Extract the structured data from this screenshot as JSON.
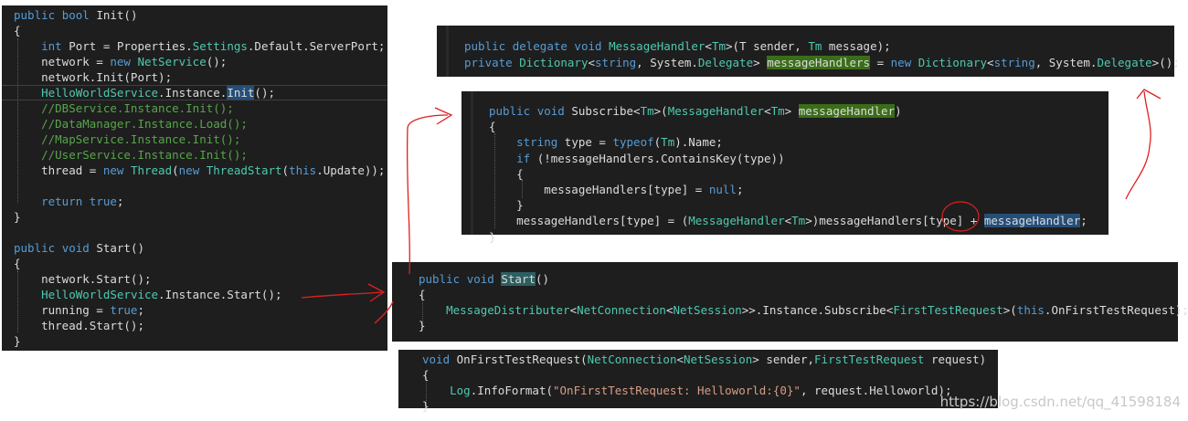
{
  "panel_init": {
    "lines": [
      [
        {
          "t": "public ",
          "c": "kw"
        },
        {
          "t": "bool ",
          "c": "kw"
        },
        {
          "t": "Init()",
          "c": ""
        }
      ],
      [
        {
          "t": "{",
          "c": ""
        }
      ],
      [
        {
          "t": "    ",
          "c": ""
        },
        {
          "t": "int ",
          "c": "kw"
        },
        {
          "t": "Port = Properties.",
          "c": ""
        },
        {
          "t": "Settings",
          "c": "ty"
        },
        {
          "t": ".Default.ServerPort;",
          "c": ""
        }
      ],
      [
        {
          "t": "    network = ",
          "c": ""
        },
        {
          "t": "new ",
          "c": "kw"
        },
        {
          "t": "NetService",
          "c": "ty"
        },
        {
          "t": "();",
          "c": ""
        }
      ],
      [
        {
          "t": "    network.Init(Port);",
          "c": ""
        }
      ],
      [
        {
          "t": "    ",
          "c": ""
        },
        {
          "t": "HelloWorldService",
          "c": "ty"
        },
        {
          "t": ".Instance.",
          "c": ""
        },
        {
          "t": "Init",
          "c": "hl-blue"
        },
        {
          "t": "();",
          "c": ""
        }
      ],
      [
        {
          "t": "    //DBService.Instance.Init();",
          "c": "cm"
        }
      ],
      [
        {
          "t": "    //DataManager.Instance.Load();",
          "c": "cm"
        }
      ],
      [
        {
          "t": "    //MapService.Instance.Init();",
          "c": "cm"
        }
      ],
      [
        {
          "t": "    //UserService.Instance.Init();",
          "c": "cm"
        }
      ],
      [
        {
          "t": "    thread = ",
          "c": ""
        },
        {
          "t": "new ",
          "c": "kw"
        },
        {
          "t": "Thread",
          "c": "ty"
        },
        {
          "t": "(",
          "c": ""
        },
        {
          "t": "new ",
          "c": "kw"
        },
        {
          "t": "ThreadStart",
          "c": "ty"
        },
        {
          "t": "(",
          "c": ""
        },
        {
          "t": "this",
          "c": "kw"
        },
        {
          "t": ".Update));",
          "c": ""
        }
      ],
      [
        {
          "t": "",
          "c": ""
        }
      ],
      [
        {
          "t": "    ",
          "c": ""
        },
        {
          "t": "return ",
          "c": "kw"
        },
        {
          "t": "true",
          "c": "kw"
        },
        {
          "t": ";",
          "c": ""
        }
      ],
      [
        {
          "t": "}",
          "c": ""
        }
      ],
      [
        {
          "t": "",
          "c": ""
        }
      ],
      [
        {
          "t": "public ",
          "c": "kw"
        },
        {
          "t": "void ",
          "c": "kw"
        },
        {
          "t": "Start()",
          "c": ""
        }
      ],
      [
        {
          "t": "{",
          "c": ""
        }
      ],
      [
        {
          "t": "    network.Start();",
          "c": ""
        }
      ],
      [
        {
          "t": "    ",
          "c": ""
        },
        {
          "t": "HelloWorldService",
          "c": "ty"
        },
        {
          "t": ".Instance.Start();",
          "c": ""
        }
      ],
      [
        {
          "t": "    running = ",
          "c": ""
        },
        {
          "t": "true",
          "c": "kw"
        },
        {
          "t": ";",
          "c": ""
        }
      ],
      [
        {
          "t": "    thread.Start();",
          "c": ""
        }
      ],
      [
        {
          "t": "}",
          "c": ""
        }
      ]
    ]
  },
  "panel_delegate": {
    "lines": [
      [
        {
          "t": "public ",
          "c": "kw"
        },
        {
          "t": "delegate ",
          "c": "kw"
        },
        {
          "t": "void ",
          "c": "kw"
        },
        {
          "t": "MessageHandler",
          "c": "ty"
        },
        {
          "t": "<",
          "c": ""
        },
        {
          "t": "Tm",
          "c": "ty"
        },
        {
          "t": ">(T sender, ",
          "c": ""
        },
        {
          "t": "Tm",
          "c": "ty"
        },
        {
          "t": " message);",
          "c": ""
        }
      ],
      [
        {
          "t": "private ",
          "c": "kw"
        },
        {
          "t": "Dictionary",
          "c": "ty"
        },
        {
          "t": "<",
          "c": ""
        },
        {
          "t": "string",
          "c": "kw"
        },
        {
          "t": ", System.",
          "c": ""
        },
        {
          "t": "Delegate",
          "c": "ty"
        },
        {
          "t": "> ",
          "c": ""
        },
        {
          "t": "messageHandlers",
          "c": "hl-green"
        },
        {
          "t": " = ",
          "c": ""
        },
        {
          "t": "new ",
          "c": "kw"
        },
        {
          "t": "Dictionary",
          "c": "ty"
        },
        {
          "t": "<",
          "c": ""
        },
        {
          "t": "string",
          "c": "kw"
        },
        {
          "t": ", System.",
          "c": ""
        },
        {
          "t": "Delegate",
          "c": "ty"
        },
        {
          "t": ">();",
          "c": ""
        }
      ]
    ]
  },
  "panel_subscribe": {
    "lines": [
      [
        {
          "t": "public ",
          "c": "kw"
        },
        {
          "t": "void ",
          "c": "kw"
        },
        {
          "t": "Subscribe<",
          "c": ""
        },
        {
          "t": "Tm",
          "c": "ty"
        },
        {
          "t": ">(",
          "c": ""
        },
        {
          "t": "MessageHandler",
          "c": "ty"
        },
        {
          "t": "<",
          "c": ""
        },
        {
          "t": "Tm",
          "c": "ty"
        },
        {
          "t": "> ",
          "c": ""
        },
        {
          "t": "messageHandler",
          "c": "hl-green"
        },
        {
          "t": ")",
          "c": ""
        }
      ],
      [
        {
          "t": "{",
          "c": ""
        }
      ],
      [
        {
          "t": "    ",
          "c": ""
        },
        {
          "t": "string ",
          "c": "kw"
        },
        {
          "t": "type = ",
          "c": ""
        },
        {
          "t": "typeof",
          "c": "kw"
        },
        {
          "t": "(",
          "c": ""
        },
        {
          "t": "Tm",
          "c": "ty"
        },
        {
          "t": ").Name;",
          "c": ""
        }
      ],
      [
        {
          "t": "    ",
          "c": ""
        },
        {
          "t": "if ",
          "c": "kw"
        },
        {
          "t": "(!messageHandlers.ContainsKey(type))",
          "c": ""
        }
      ],
      [
        {
          "t": "    {",
          "c": ""
        }
      ],
      [
        {
          "t": "        messageHandlers[type] = ",
          "c": ""
        },
        {
          "t": "null",
          "c": "kw"
        },
        {
          "t": ";",
          "c": ""
        }
      ],
      [
        {
          "t": "    }",
          "c": ""
        }
      ],
      [
        {
          "t": "    messageHandlers[type] = (",
          "c": ""
        },
        {
          "t": "MessageHandler",
          "c": "ty"
        },
        {
          "t": "<",
          "c": ""
        },
        {
          "t": "Tm",
          "c": "ty"
        },
        {
          "t": ">)messageHandlers[type] + ",
          "c": ""
        },
        {
          "t": "messageHandler",
          "c": "hl-blue"
        },
        {
          "t": ";",
          "c": ""
        }
      ],
      [
        {
          "t": "}",
          "c": ""
        }
      ]
    ]
  },
  "panel_start": {
    "lines": [
      [
        {
          "t": "public ",
          "c": "kw"
        },
        {
          "t": "void ",
          "c": "kw"
        },
        {
          "t": "Start",
          "c": "hl-teal"
        },
        {
          "t": "()",
          "c": ""
        }
      ],
      [
        {
          "t": "{",
          "c": ""
        }
      ],
      [
        {
          "t": "    ",
          "c": ""
        },
        {
          "t": "MessageDistributer",
          "c": "ty"
        },
        {
          "t": "<",
          "c": ""
        },
        {
          "t": "NetConnection",
          "c": "ty"
        },
        {
          "t": "<",
          "c": ""
        },
        {
          "t": "NetSession",
          "c": "ty"
        },
        {
          "t": ">>.Instance.Subscribe<",
          "c": ""
        },
        {
          "t": "FirstTestRequest",
          "c": "ty"
        },
        {
          "t": ">(",
          "c": ""
        },
        {
          "t": "this",
          "c": "kw"
        },
        {
          "t": ".OnFirstTestRequest);",
          "c": ""
        }
      ],
      [
        {
          "t": "}",
          "c": ""
        }
      ]
    ]
  },
  "panel_handler": {
    "lines": [
      [
        {
          "t": "void ",
          "c": "kw"
        },
        {
          "t": "OnFirstTestRequest(",
          "c": ""
        },
        {
          "t": "NetConnection",
          "c": "ty"
        },
        {
          "t": "<",
          "c": ""
        },
        {
          "t": "NetSession",
          "c": "ty"
        },
        {
          "t": "> sender,",
          "c": ""
        },
        {
          "t": "FirstTestRequest",
          "c": "ty"
        },
        {
          "t": " request)",
          "c": ""
        }
      ],
      [
        {
          "t": "{",
          "c": ""
        }
      ],
      [
        {
          "t": "    ",
          "c": ""
        },
        {
          "t": "Log",
          "c": "ty"
        },
        {
          "t": ".InfoFormat(",
          "c": ""
        },
        {
          "t": "\"OnFirstTestRequest: Helloworld:{0}\"",
          "c": "st"
        },
        {
          "t": ", request.Helloworld);",
          "c": ""
        }
      ],
      [
        {
          "t": "}",
          "c": ""
        }
      ]
    ]
  },
  "watermark": "https://blog.csdn.net/qq_41598184",
  "colors": {
    "editor_bg": "#1e1e1e",
    "keyword": "#569cd6",
    "type": "#4ec9b0",
    "comment": "#57a64a",
    "string": "#d69d85",
    "annotation": "#e02020"
  }
}
